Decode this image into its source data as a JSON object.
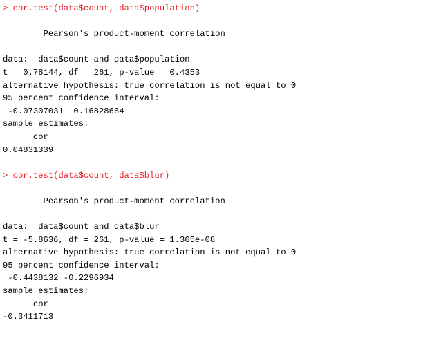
{
  "colors": {
    "command": "#e8202a",
    "output": "#000000",
    "background": "#ffffff"
  },
  "blocks": [
    {
      "command": "> cor.test(data$count, data$population)",
      "title": "        Pearson's product-moment correlation",
      "data_line": "data:  data$count and data$population",
      "stat_line": "t = 0.78144, df = 261, p-value = 0.4353",
      "alt_line": "alternative hypothesis: true correlation is not equal to 0",
      "ci_label": "95 percent confidence interval:",
      "ci_values": " -0.07307031  0.16828664",
      "est_label": "sample estimates:",
      "est_name": "      cor ",
      "est_value": "0.04831339"
    },
    {
      "command": "> cor.test(data$count, data$blur)",
      "title": "        Pearson's product-moment correlation",
      "data_line": "data:  data$count and data$blur",
      "stat_line": "t = -5.8636, df = 261, p-value = 1.365e-08",
      "alt_line": "alternative hypothesis: true correlation is not equal to 0",
      "ci_label": "95 percent confidence interval:",
      "ci_values": " -0.4438132 -0.2296934",
      "est_label": "sample estimates:",
      "est_name": "      cor ",
      "est_value": "-0.3411713"
    }
  ]
}
